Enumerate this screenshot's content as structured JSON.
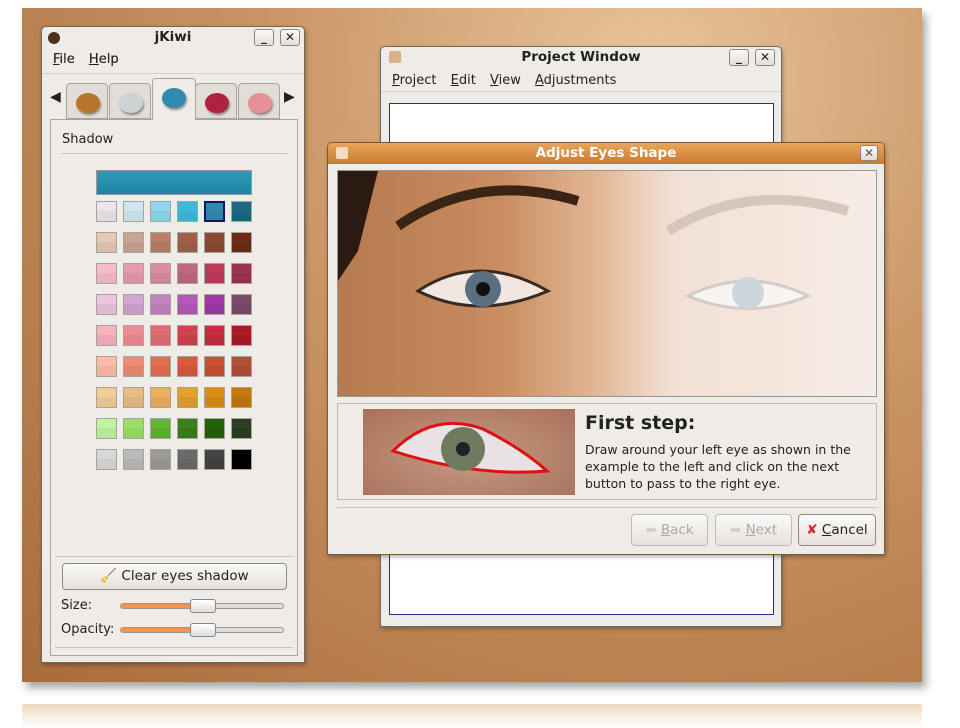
{
  "jkiwi": {
    "title": "jKiwi",
    "minimize": "_",
    "close": "✕",
    "menu": [
      {
        "label": "File",
        "key": "F",
        "rest": "ile"
      },
      {
        "label": "Help",
        "key": "H",
        "rest": "elp"
      }
    ],
    "tabs": [
      "hair",
      "cream",
      "eye-shadow",
      "blush",
      "lipstick"
    ],
    "active_tab": 2,
    "section": "Shadow",
    "selected_color": "#2f9ab8",
    "palette": [
      [
        "#ece6ec",
        "#cfe8f0",
        "#8fd8ee",
        "#40b8dc",
        "#2f8cb0",
        "#1a6a80"
      ],
      [
        "#e6c8b8",
        "#caa494",
        "#b88068",
        "#a0604a",
        "#8a4a34",
        "#6e2c14"
      ],
      [
        "#f6bccc",
        "#e69aac",
        "#dc8ea0",
        "#c0687e",
        "#c03a58",
        "#9a3450"
      ],
      [
        "#ecc4e0",
        "#d4a4d4",
        "#c084c0",
        "#b458bc",
        "#a038a8",
        "#7a4a6a"
      ],
      [
        "#f8b2be",
        "#ec8c90",
        "#e46c70",
        "#cc4450",
        "#c82c40",
        "#a81c28"
      ],
      [
        "#fcbca8",
        "#ee8c74",
        "#e66c50",
        "#d85a3c",
        "#cc5034",
        "#b05038"
      ],
      [
        "#f4cc98",
        "#e8bc84",
        "#ecb060",
        "#e4a030",
        "#dc8c14",
        "#c47810"
      ],
      [
        "#c0f4a0",
        "#98e068",
        "#60b830",
        "#3a801c",
        "#24600c",
        "#2a4020"
      ],
      [
        "#d8d8d8",
        "#bababa",
        "#9a9a9a",
        "#6a6a6a",
        "#444444",
        "#000000"
      ]
    ],
    "selected": {
      "row": 0,
      "col": 4
    },
    "clear_button": "Clear eyes shadow",
    "size_label": "Size:",
    "size_value": 0.5,
    "opacity_label": "Opacity:",
    "opacity_value": 0.5
  },
  "project": {
    "title": "Project Window",
    "minimize": "_",
    "close": "✕",
    "menu": [
      {
        "key": "P",
        "rest": "roject"
      },
      {
        "key": "E",
        "rest": "dit"
      },
      {
        "key": "V",
        "rest": "iew"
      },
      {
        "key": "A",
        "rest": "djustments"
      }
    ]
  },
  "dialog": {
    "title": "Adjust Eyes Shape",
    "close": "✕",
    "step_title": "First step:",
    "step_text": "Draw around your left eye as shown in the example to the left and click on the next button to pass to the right eye.",
    "back": {
      "key": "B",
      "rest": "ack"
    },
    "next": {
      "key": "N",
      "rest": "ext"
    },
    "cancel": {
      "key": "C",
      "rest": "ancel"
    },
    "accent": "#d98a3a"
  }
}
